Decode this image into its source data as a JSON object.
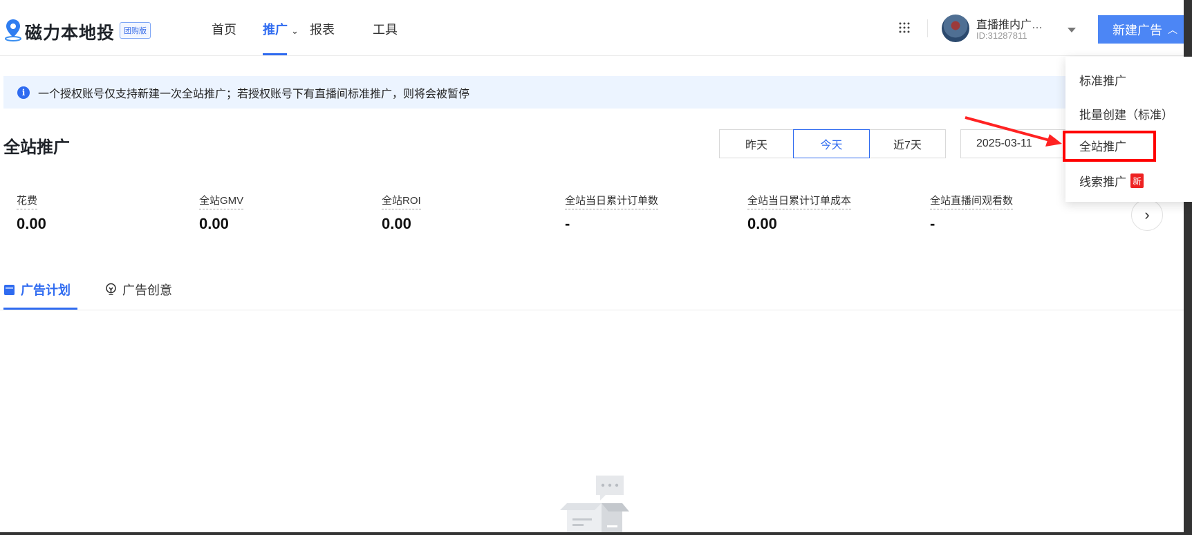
{
  "header": {
    "logo_text": "磁力本地投",
    "edition": "团购版",
    "nav": [
      {
        "label": "首页"
      },
      {
        "label": "推广"
      },
      {
        "label": "报表"
      },
      {
        "label": "工具"
      }
    ],
    "account_name": "直播推内广…",
    "account_id": "ID:31287811",
    "new_ad_button": "新建广告"
  },
  "dropdown": {
    "items": [
      {
        "label": "标准推广"
      },
      {
        "label": "批量创建（标准）"
      },
      {
        "label": "全站推广"
      },
      {
        "label": "线索推广"
      }
    ],
    "new_badge": "新"
  },
  "alert": {
    "text": "一个授权账号仅支持新建一次全站推广；若授权账号下有直播间标准推广，则将会被暂停"
  },
  "page": {
    "title": "全站推广",
    "date_ranges": [
      {
        "label": "昨天"
      },
      {
        "label": "今天"
      },
      {
        "label": "近7天"
      }
    ],
    "date_value": "2025-03-11"
  },
  "metrics": [
    {
      "label": "花费",
      "value": "0.00"
    },
    {
      "label": "全站GMV",
      "value": "0.00"
    },
    {
      "label": "全站ROI",
      "value": "0.00"
    },
    {
      "label": "全站当日累计订单数",
      "value": "-"
    },
    {
      "label": "全站当日累计订单成本",
      "value": "0.00"
    },
    {
      "label": "全站直播间观看数",
      "value": "-"
    }
  ],
  "tabs": [
    {
      "label": "广告计划"
    },
    {
      "label": "广告创意"
    }
  ],
  "colors": {
    "primary": "#2f6bf0",
    "button": "#4c86f5",
    "annotation": "#ff0000"
  }
}
